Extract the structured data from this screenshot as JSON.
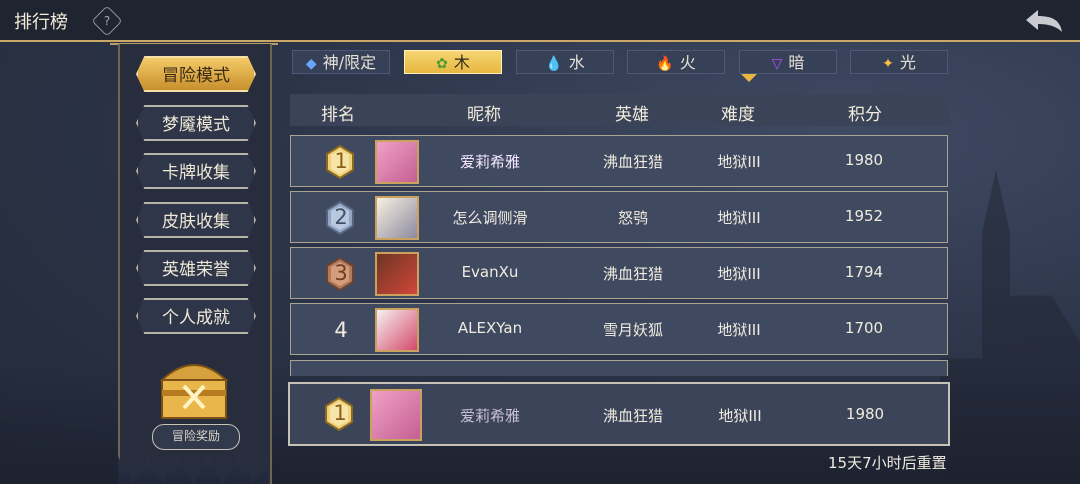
{
  "header": {
    "title": "排行榜",
    "help_icon": "?"
  },
  "sidebar": {
    "items": [
      {
        "label": "冒险模式",
        "active": true
      },
      {
        "label": "梦魇模式",
        "active": false
      },
      {
        "label": "卡牌收集",
        "active": false
      },
      {
        "label": "皮肤收集",
        "active": false
      },
      {
        "label": "英雄荣誉",
        "active": false
      },
      {
        "label": "个人成就",
        "active": false
      }
    ],
    "reward_label": "冒险奖励"
  },
  "tabs": [
    {
      "label": "神/限定",
      "icon": "◆",
      "active": false
    },
    {
      "label": "木",
      "icon": "✿",
      "active": true
    },
    {
      "label": "水",
      "icon": "💧",
      "active": false
    },
    {
      "label": "火",
      "icon": "🔥",
      "active": false
    },
    {
      "label": "暗",
      "icon": "▽",
      "active": false
    },
    {
      "label": "光",
      "icon": "✦",
      "active": false
    }
  ],
  "table": {
    "columns": [
      "排名",
      "昵称",
      "英雄",
      "难度",
      "积分"
    ],
    "rows": [
      {
        "rank": "1",
        "nickname": "爱莉希雅",
        "hero": "沸血狂猎",
        "difficulty": "地狱III",
        "score": "1980"
      },
      {
        "rank": "2",
        "nickname": "怎么调侧滑",
        "hero": "怒鸮",
        "difficulty": "地狱III",
        "score": "1952"
      },
      {
        "rank": "3",
        "nickname": "EvanXu",
        "hero": "沸血狂猎",
        "difficulty": "地狱III",
        "score": "1794"
      },
      {
        "rank": "4",
        "nickname": "ALEXYan",
        "hero": "雪月妖狐",
        "difficulty": "地狱III",
        "score": "1700"
      }
    ],
    "my_row": {
      "rank": "1",
      "nickname": "爱莉希雅",
      "hero": "沸血狂猎",
      "difficulty": "地狱III",
      "score": "1980"
    }
  },
  "reset_text": "15天7小时后重置",
  "colors": {
    "accent_gold": "#e7b740",
    "panel": "#3f4960",
    "border": "#a8a493"
  }
}
